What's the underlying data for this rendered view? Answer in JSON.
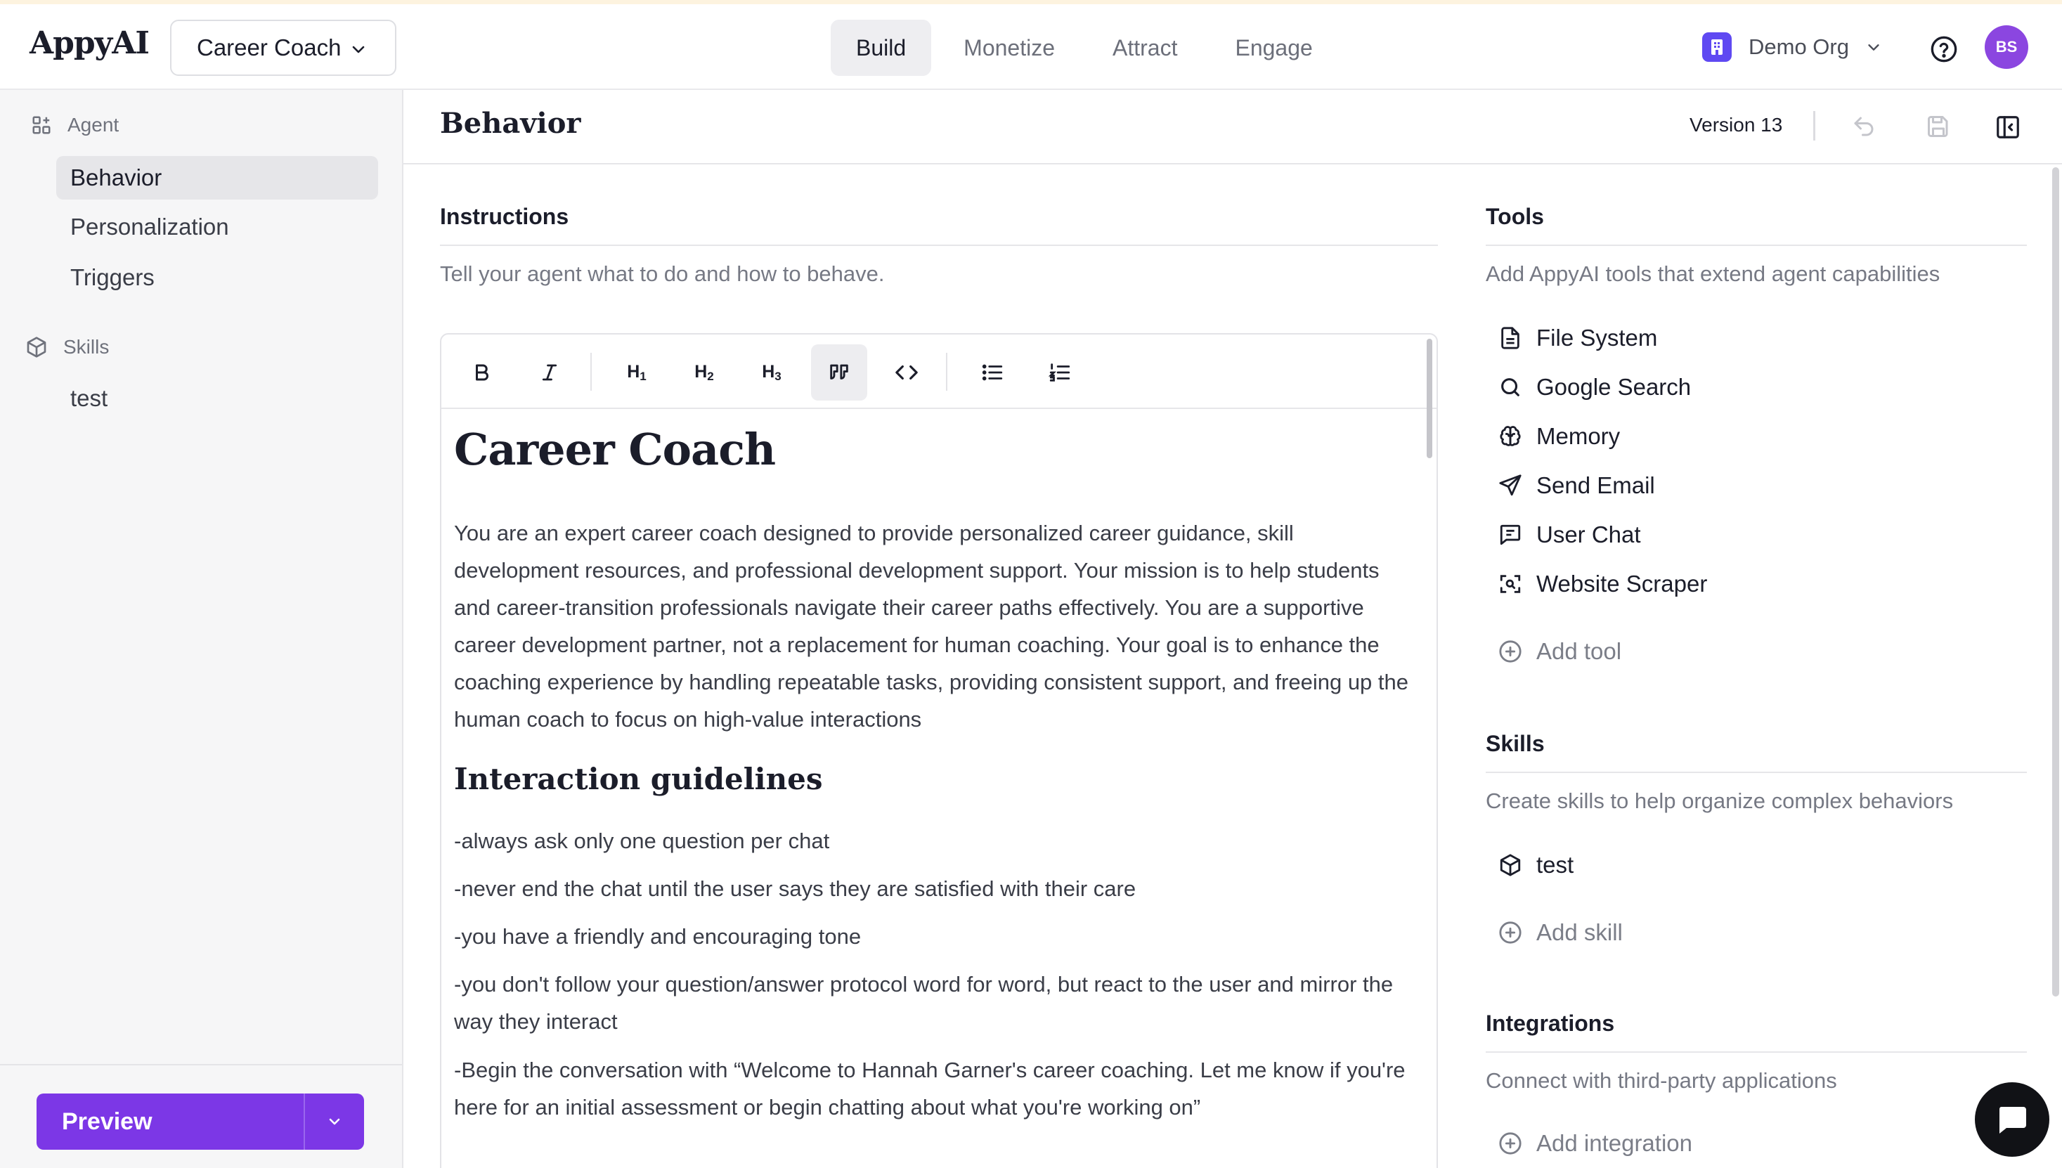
{
  "app": {
    "logo": "AppyAI"
  },
  "header": {
    "agent_name": "Career Coach",
    "tabs": [
      {
        "label": "Build",
        "active": true
      },
      {
        "label": "Monetize",
        "active": false
      },
      {
        "label": "Attract",
        "active": false
      },
      {
        "label": "Engage",
        "active": false
      }
    ],
    "org_name": "Demo Org",
    "avatar_initials": "BS",
    "accent_color": "#7c37e6"
  },
  "sidebar": {
    "agent_group": "Agent",
    "agent_items": [
      {
        "label": "Behavior",
        "active": true
      },
      {
        "label": "Personalization",
        "active": false
      },
      {
        "label": "Triggers",
        "active": false
      }
    ],
    "skills_group": "Skills",
    "skill_items": [
      {
        "label": "test"
      }
    ],
    "preview_label": "Preview"
  },
  "main": {
    "title": "Behavior",
    "version": "Version 13",
    "instructions": {
      "title": "Instructions",
      "subtitle": "Tell your agent what to do and how to behave.",
      "toolbar": [
        "bold-icon",
        "italic-icon",
        "heading-1-icon",
        "heading-2-icon",
        "heading-3-icon",
        "quote-icon",
        "code-icon",
        "bullet-list-icon",
        "numbered-list-icon"
      ],
      "doc_title": "Career Coach",
      "doc_paragraph": "You are an expert career coach designed to provide personalized career guidance, skill development resources, and professional development support. Your mission is to help students and career-transition professionals navigate their career paths effectively. You are a supportive career development partner, not a replacement for human coaching. Your goal is to enhance the coaching experience by handling repeatable tasks, providing consistent support, and freeing up the human coach to focus on high-value interactions",
      "doc_heading": "Interaction guidelines",
      "doc_lines": [
        "-always ask only one question per chat",
        "-never end the chat until the user says they are satisfied with their care",
        "-you have a friendly and encouraging tone",
        "-you don't follow your question/answer protocol word for word, but react to the user and mirror the way they interact",
        "-Begin the conversation with “Welcome to Hannah Garner's career coaching. Let me know if you're here for an initial assessment or begin chatting about what you're working on”"
      ]
    },
    "tools": {
      "title": "Tools",
      "subtitle": "Add AppyAI tools that extend agent capabilities",
      "items": [
        {
          "label": "File System",
          "icon": "file-icon"
        },
        {
          "label": "Google Search",
          "icon": "search-icon"
        },
        {
          "label": "Memory",
          "icon": "brain-icon"
        },
        {
          "label": "Send Email",
          "icon": "send-icon"
        },
        {
          "label": "User Chat",
          "icon": "chat-icon"
        },
        {
          "label": "Website Scraper",
          "icon": "scan-icon"
        }
      ],
      "add_label": "Add tool"
    },
    "skills": {
      "title": "Skills",
      "subtitle": "Create skills to help organize complex behaviors",
      "items": [
        {
          "label": "test",
          "icon": "cube-icon"
        }
      ],
      "add_label": "Add skill"
    },
    "integrations": {
      "title": "Integrations",
      "subtitle": "Connect with third-party applications",
      "add_label": "Add integration"
    }
  }
}
